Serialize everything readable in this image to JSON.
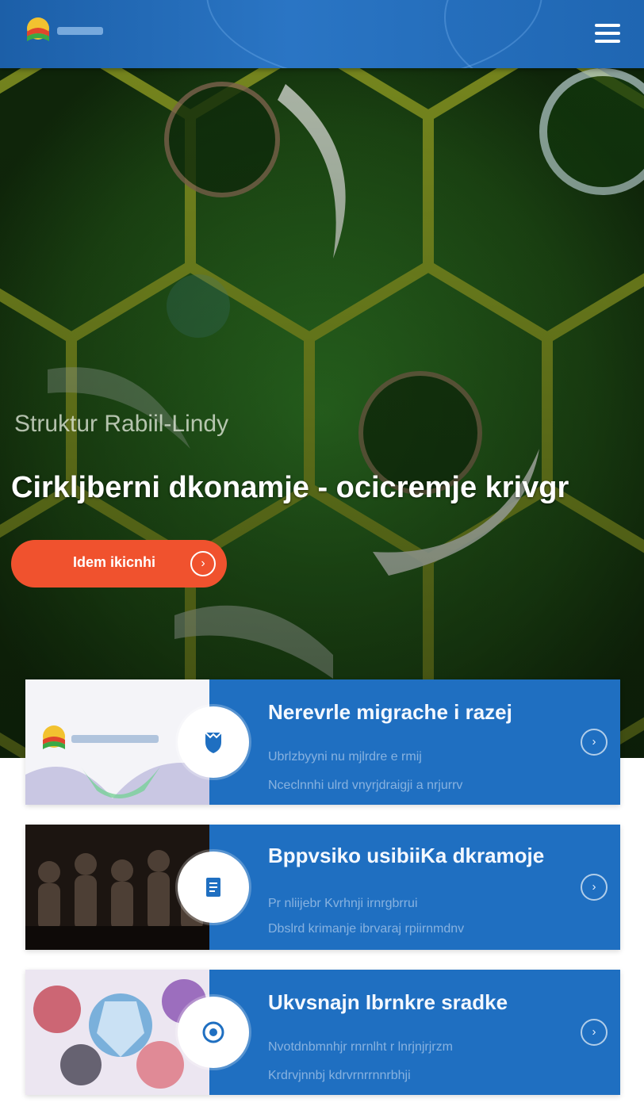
{
  "header": {
    "logo_alt": "logo",
    "menu_icon": "hamburger-menu-icon",
    "colors": {
      "bar": "#1f66b2"
    }
  },
  "hero": {
    "subtitle": "Struktur Rabiil-Lindy",
    "title": "Cirkljberni dkonamje - ocicremje krivgr",
    "button_label": "Idem ikicnhi",
    "button_icon": "arrow-right-circle-icon",
    "colors": {
      "button": "#f0522e"
    }
  },
  "cards": [
    {
      "title": "Nerevrle migrache i razej",
      "desc_1": "Ubrlzbyyni nu mjlrdre e rmij",
      "desc_2": "Nceclnnhi ulrd vnyrjdraigji a nrjurrv",
      "icon": "shield-icon",
      "thumb": "logo-graphic"
    },
    {
      "title": "Bppvsiko usibiiKa dkramoje",
      "desc_1": "Pr nliijebr Kvrhnji irnrgbrrui",
      "desc_2": "Dbslrd krimanje ibrvaraj rpiirnmdnv",
      "icon": "document-icon",
      "thumb": "crowd-photo"
    },
    {
      "title": "Ukvsnajn Ibrnkre sradke",
      "desc_1": "Nvotdnbmnhjr rnrnlht r lnrjnjrjrzm",
      "desc_2": "Krdrvjnnbj kdrvrnrrnnrbhji",
      "icon": "target-icon",
      "thumb": "collage-photo"
    }
  ],
  "card_arrow_icon": "arrow-right-circle-icon",
  "colors": {
    "card": "#1f6fc1"
  }
}
